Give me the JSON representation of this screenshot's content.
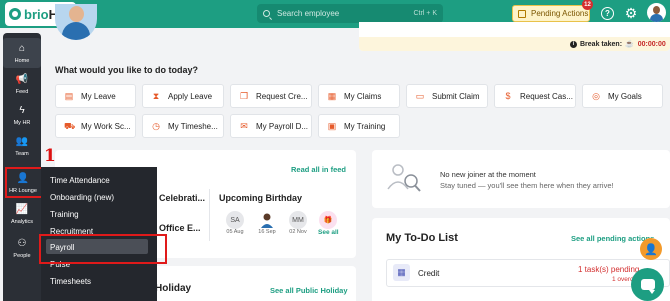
{
  "header": {
    "logo_text_a": "brio",
    "logo_text_b": "HR",
    "search_placeholder": "Search employee",
    "search_shortcut": "Ctrl + K",
    "pending_actions_label": "Pending Actions",
    "pending_count": "12"
  },
  "sidebar": {
    "items": [
      {
        "label": "Home",
        "icon": "home-icon"
      },
      {
        "label": "Feed",
        "icon": "megaphone-icon"
      },
      {
        "label": "My HR",
        "icon": "bolt-icon"
      },
      {
        "label": "Team",
        "icon": "team-icon"
      },
      {
        "label": "HR Lounge",
        "icon": "user-gear-icon"
      },
      {
        "label": "Analytics",
        "icon": "chart-icon"
      },
      {
        "label": "People",
        "icon": "org-chart-icon"
      }
    ],
    "annotation_number": "1"
  },
  "flyout": {
    "items": [
      "Time Attendance",
      "Onboarding (new)",
      "Training",
      "Recruitment",
      "Payroll",
      "Pulse",
      "Timesheets"
    ]
  },
  "break": {
    "label": "Break taken:",
    "value": "00:00:00"
  },
  "quick_actions": {
    "title": "What would you like to do today?",
    "buttons": [
      "My Leave",
      "Apply Leave",
      "Request Cre...",
      "My Claims",
      "Submit Claim",
      "Request Cas...",
      "My Goals",
      "My Work Sc...",
      "My Timeshe...",
      "My Payroll D...",
      "My Training"
    ]
  },
  "feed": {
    "read_all": "Read all in feed",
    "celebrations": "Celebrati...",
    "office": "Office E...",
    "upcoming_birthday": "Upcoming Birthday",
    "birthdays": [
      {
        "initials": "SA",
        "date": "05 Aug"
      },
      {
        "initials": "",
        "date": "16 Sep"
      },
      {
        "initials": "MM",
        "date": "02 Nov"
      }
    ],
    "see_all": "See all"
  },
  "holiday": {
    "title": "Holiday",
    "link": "See all Public Holiday"
  },
  "joiner": {
    "title": "No new joiner at the moment",
    "subtitle": "Stay tuned — you'll see them here when they arrive!"
  },
  "todo": {
    "title": "My To-Do List",
    "link": "See all pending actions",
    "rows": [
      {
        "name": "Credit",
        "count": "1 task(s) pending",
        "overdue": "1 overdue"
      }
    ]
  }
}
